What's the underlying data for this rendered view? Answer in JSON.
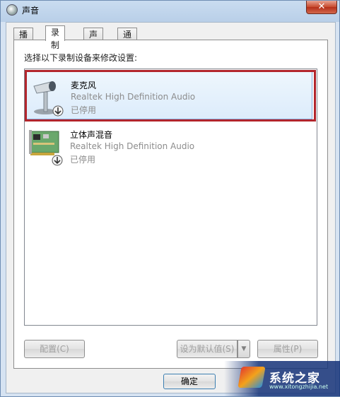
{
  "window": {
    "title": "声音",
    "close_label": "✕"
  },
  "tabs": [
    {
      "label": "播放",
      "active": false
    },
    {
      "label": "录制",
      "active": true
    },
    {
      "label": "声音",
      "active": false
    },
    {
      "label": "通信",
      "active": false
    }
  ],
  "panel": {
    "instruction": "选择以下录制设备来修改设置:"
  },
  "devices": [
    {
      "name": "麦克风",
      "driver": "Realtek High Definition Audio",
      "status": "已停用",
      "icon": "microphone-icon",
      "selected": true
    },
    {
      "name": "立体声混音",
      "driver": "Realtek High Definition Audio",
      "status": "已停用",
      "icon": "sound-card-icon",
      "selected": false
    }
  ],
  "buttons": {
    "configure": "配置(C)",
    "set_default": "设为默认值(S)",
    "properties": "属性(P)",
    "ok": "确定"
  },
  "watermark": {
    "text": "系统之家",
    "url": "www.xitongzhijia.net"
  },
  "colors": {
    "highlight_box": "#b2252c",
    "selection": "#dcecfb"
  }
}
